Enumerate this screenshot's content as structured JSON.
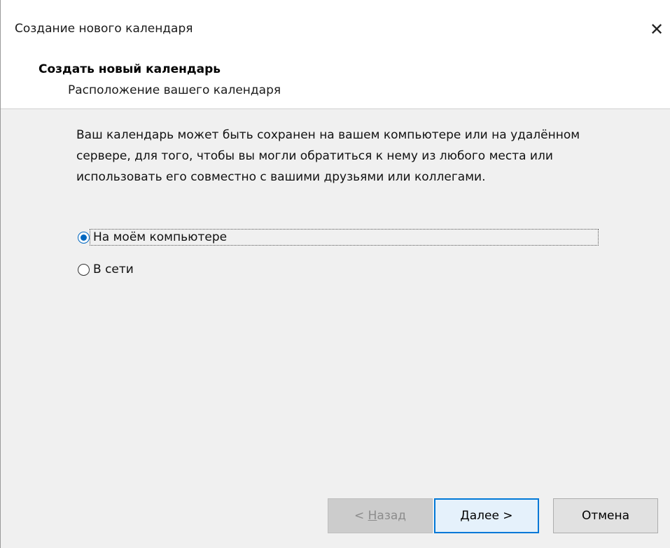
{
  "window": {
    "title": "Создание нового календаря",
    "close_icon": "close-icon"
  },
  "header": {
    "title": "Создать новый календарь",
    "subtitle": "Расположение вашего календаря"
  },
  "content": {
    "description": "Ваш календарь может быть сохранен на вашем компьютере или на удалённом сервере, для того, чтобы вы могли обратиться к нему из любого места или использовать его совместно с вашими друзьями или коллегами.",
    "options": [
      {
        "label": "На моём компьютере",
        "selected": true
      },
      {
        "label": "В сети",
        "selected": false
      }
    ]
  },
  "buttons": {
    "back_prefix": "< ",
    "back_accel": "Н",
    "back_rest": "азад",
    "next": "Далее >",
    "cancel": "Отмена"
  },
  "colors": {
    "accent": "#0067c0",
    "primary_button_border": "#0078d7",
    "body_bg": "#f0f0f0"
  }
}
